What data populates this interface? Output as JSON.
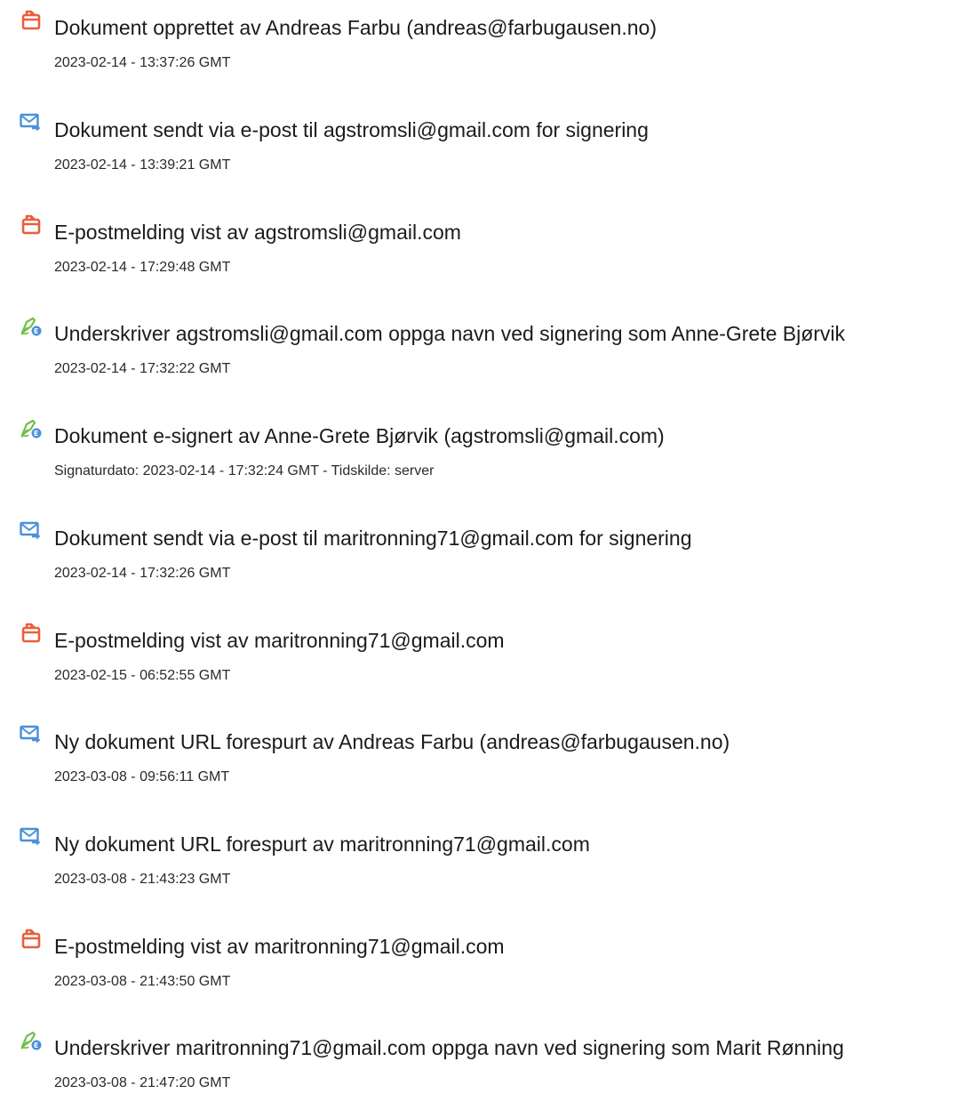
{
  "colors": {
    "document_icon": "#e8603c",
    "email_icon": "#4a90d9",
    "sign_icon_pen": "#6fbf4a",
    "sign_icon_badge": "#4a90d9"
  },
  "entries": [
    {
      "icon": "document-icon",
      "title": "Dokument opprettet av Andreas Farbu (andreas@farbugausen.no)",
      "detail": "2023-02-14 - 13:37:26 GMT"
    },
    {
      "icon": "email-send-icon",
      "title": "Dokument sendt via e-post til agstromsli@gmail.com for signering",
      "detail": "2023-02-14 - 13:39:21 GMT"
    },
    {
      "icon": "document-icon",
      "title": "E-postmelding vist av agstromsli@gmail.com",
      "detail": "2023-02-14 - 17:29:48 GMT"
    },
    {
      "icon": "e-sign-icon",
      "title": "Underskriver agstromsli@gmail.com oppga navn ved signering som Anne-Grete Bjørvik",
      "detail": "2023-02-14 - 17:32:22 GMT"
    },
    {
      "icon": "e-sign-icon",
      "title": "Dokument e-signert av Anne-Grete Bjørvik (agstromsli@gmail.com)",
      "detail": "Signaturdato: 2023-02-14 - 17:32:24 GMT - Tidskilde: server"
    },
    {
      "icon": "email-send-icon",
      "title": "Dokument sendt via e-post til maritronning71@gmail.com for signering",
      "detail": "2023-02-14 - 17:32:26 GMT"
    },
    {
      "icon": "document-icon",
      "title": "E-postmelding vist av maritronning71@gmail.com",
      "detail": "2023-02-15 - 06:52:55 GMT"
    },
    {
      "icon": "email-send-icon",
      "title": "Ny dokument URL forespurt av Andreas Farbu (andreas@farbugausen.no)",
      "detail": "2023-03-08 - 09:56:11 GMT"
    },
    {
      "icon": "email-send-icon",
      "title": "Ny dokument URL forespurt av maritronning71@gmail.com",
      "detail": "2023-03-08 - 21:43:23 GMT"
    },
    {
      "icon": "document-icon",
      "title": "E-postmelding vist av maritronning71@gmail.com",
      "detail": "2023-03-08 - 21:43:50 GMT"
    },
    {
      "icon": "e-sign-icon",
      "title": "Underskriver maritronning71@gmail.com oppga navn ved signering som Marit Rønning",
      "detail": "2023-03-08 - 21:47:20 GMT"
    }
  ]
}
